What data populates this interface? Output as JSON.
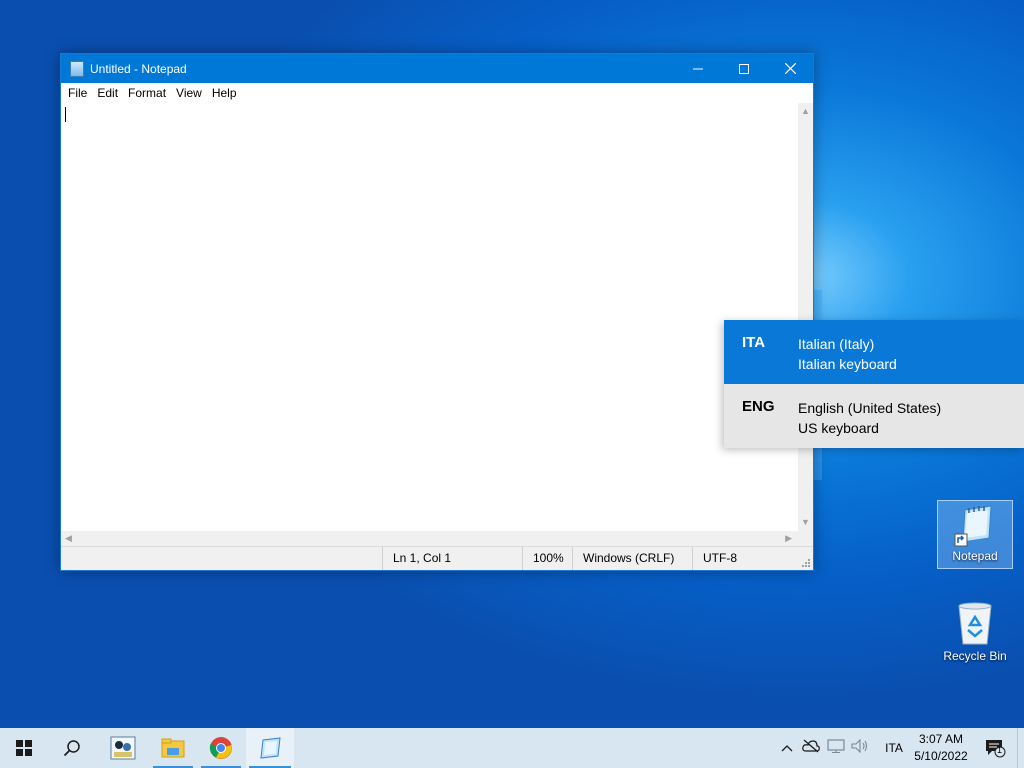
{
  "window": {
    "title": "Untitled - Notepad",
    "menu": [
      "File",
      "Edit",
      "Format",
      "View",
      "Help"
    ],
    "status": {
      "position": "Ln 1, Col 1",
      "zoom": "100%",
      "line_ending": "Windows (CRLF)",
      "encoding": "UTF-8"
    }
  },
  "language_flyout": {
    "items": [
      {
        "code": "ITA",
        "language": "Italian (Italy)",
        "keyboard": "Italian keyboard",
        "selected": true
      },
      {
        "code": "ENG",
        "language": "English (United States)",
        "keyboard": "US keyboard",
        "selected": false
      }
    ]
  },
  "desktop_icons": {
    "notepad": "Notepad",
    "recycle_bin": "Recycle Bin"
  },
  "taskbar": {
    "input_indicator": "ITA",
    "time": "3:07 AM",
    "date": "5/10/2022",
    "notification_count": "1"
  },
  "colors": {
    "accent": "#0078d7",
    "taskbar": "#d8e6f2",
    "flyout": "#e6e6e6"
  }
}
